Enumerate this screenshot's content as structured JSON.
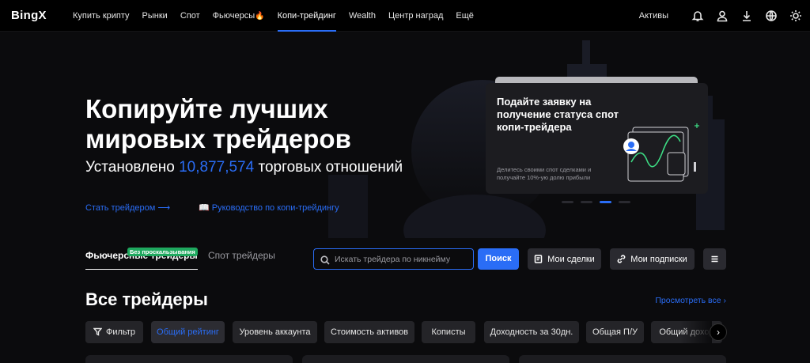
{
  "nav": {
    "logo": "BingX",
    "items": [
      {
        "label": "Купить крипту"
      },
      {
        "label": "Рынки"
      },
      {
        "label": "Спот"
      },
      {
        "label": "Фьючерсы",
        "suffix_icon": "fire-icon"
      },
      {
        "label": "Копи-трейдинг",
        "active": true
      },
      {
        "label": "Wealth"
      },
      {
        "label": "Центр наград"
      },
      {
        "label": "Ещё"
      }
    ],
    "assets_label": "Активы",
    "right_icons": [
      "bell-icon",
      "user-icon",
      "download-icon",
      "globe-icon",
      "sun-icon"
    ]
  },
  "hero": {
    "title": "Копируйте лучших мировых трейдеров",
    "subtitle_prefix": "Установлено",
    "subtitle_number": "10,877,574",
    "subtitle_suffix": "торговых отношений",
    "link_become": "Стать трейдером",
    "link_guide": "Руководство по копи-трейдингу",
    "promo": {
      "title": "Подайте заявку на получение статуса спот копи-трейдера",
      "description": "Делитесь своими спот сделками и получайте 10%-ую долю прибыли"
    },
    "carousel_active_index": 2,
    "carousel_count": 4
  },
  "tabs": {
    "futures": "Фьючерсные трейдеры",
    "futures_badge": "Без проскальзывания",
    "spot": "Спот трейдеры"
  },
  "search": {
    "placeholder": "Искать трейдера по никнейму",
    "value": "",
    "button": "Поиск"
  },
  "actions": {
    "my_trades": "Мои сделки",
    "my_subscriptions": "Мои подписки"
  },
  "traders": {
    "title": "Все трейдеры",
    "view_all": "Просмотреть все",
    "filters": [
      {
        "label": "Фильтр",
        "icon": "filter-icon"
      },
      {
        "label": "Общий рейтинг",
        "active": true
      },
      {
        "label": "Уровень аккаунта"
      },
      {
        "label": "Стоимость активов"
      },
      {
        "label": "Кописты"
      },
      {
        "label": "Доходность за 30дн."
      },
      {
        "label": "Общая П/У"
      },
      {
        "label": "Общий доход"
      }
    ]
  },
  "colors": {
    "accent": "#2a6df6",
    "badge_green": "#1fa95f",
    "background": "#0b0b0d",
    "nav_bg": "#000000"
  }
}
